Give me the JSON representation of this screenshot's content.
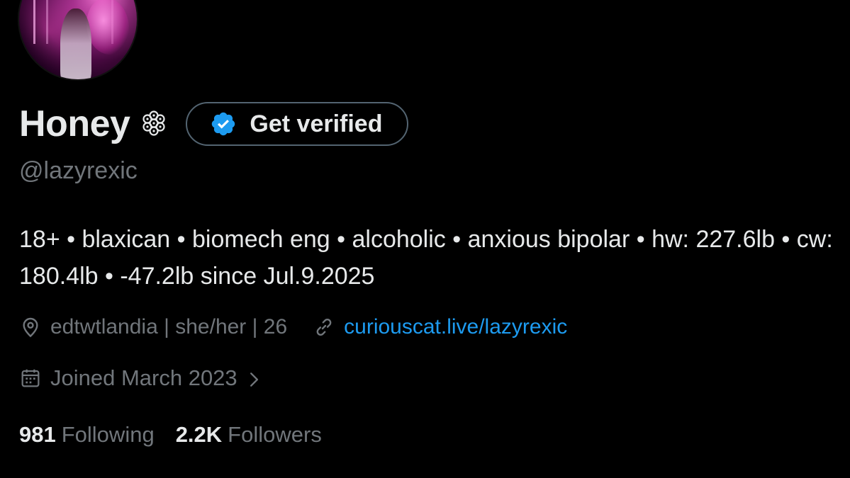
{
  "profile": {
    "display_name": "Honey",
    "handle": "@lazyrexic",
    "verify_button_label": "Get verified",
    "bio": "18+ • blaxican • biomech eng • alcoholic • anxious bipolar • hw: 227.6lb • cw: 180.4lb • -47.2lb since Jul.9.2025",
    "location": "edtwtlandia | she/her | 26",
    "website": "curiouscat.live/lazyrexic",
    "joined": "Joined March 2023",
    "following_count": "981",
    "following_label": "Following",
    "followers_count": "2.2K",
    "followers_label": "Followers"
  },
  "icons": {
    "name_emoji": "flower-icon",
    "verify": "verified-badge-icon",
    "location": "location-pin-icon",
    "link": "link-icon",
    "calendar": "calendar-icon",
    "joined_chevron": "chevron-right-icon"
  },
  "colors": {
    "background": "#000000",
    "text_primary": "#e7e9ea",
    "text_secondary": "#71767b",
    "link": "#1d9bf0",
    "verified_blue": "#1d9bf0",
    "button_border": "#536471"
  }
}
